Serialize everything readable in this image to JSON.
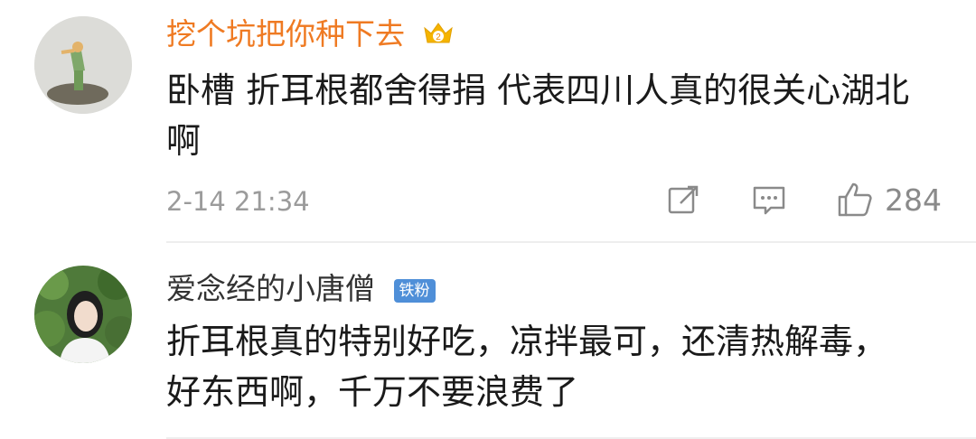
{
  "comments": [
    {
      "username": "挖个坑把你种下去",
      "username_color": "#ef7a22",
      "text_line1": "卧槽 折耳根都舍得捐 代表四川人真的很关心湖北",
      "text_line2": "啊",
      "time": "2-14 21:34",
      "likes": "284",
      "badge_icon": "crown-level-badge-icon",
      "actions": [
        "repost-icon",
        "comment-icon",
        "like-icon"
      ]
    },
    {
      "username": "爱念经的小唐僧",
      "username_color": "#333333",
      "badge_label": "铁粉",
      "text_line1": "折耳根真的特别好吃，凉拌最可，还清热解毒，",
      "text_line2": "好东西啊，千万不要浪费了"
    }
  ]
}
